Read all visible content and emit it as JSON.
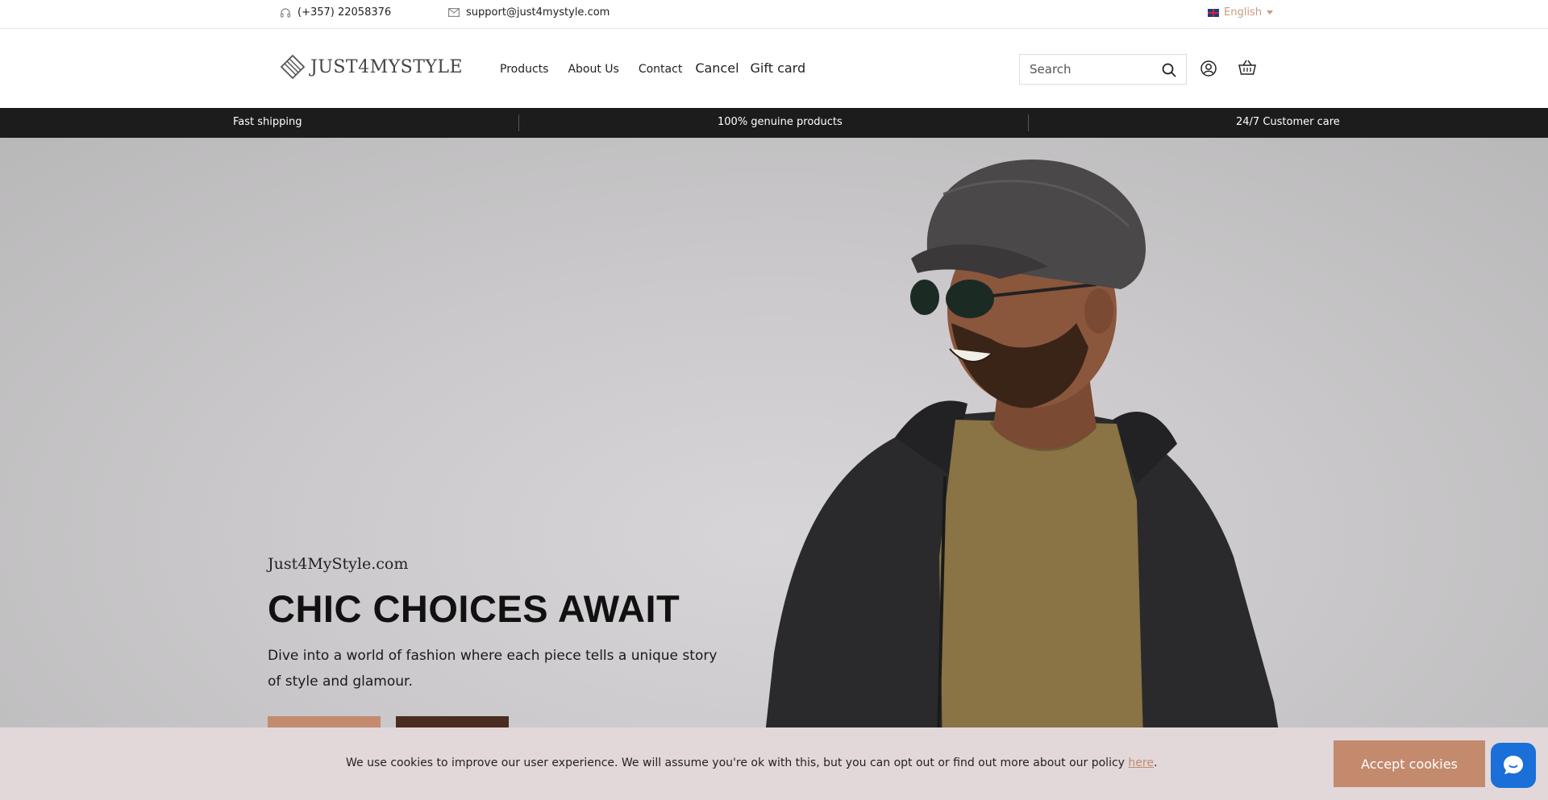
{
  "topbar": {
    "phone": "(+357) 22058376",
    "email": "support@just4mystyle.com",
    "language": "English",
    "icons": [
      "headset-icon",
      "mail-icon",
      "uk-flag-icon",
      "caret-down-icon"
    ]
  },
  "header": {
    "logo_text": "JUST4MYSTYLE",
    "nav": [
      "Products",
      "About Us",
      "Contact",
      "Cancel",
      "Gift card"
    ],
    "search_placeholder": "Search",
    "icons": [
      "search-icon",
      "user-icon",
      "basket-icon"
    ]
  },
  "strip": {
    "items": [
      "Fast shipping",
      "100% genuine products",
      "24/7 Customer care"
    ]
  },
  "hero": {
    "subtitle": "Just4MyStyle.com",
    "title": "CHIC CHOICES AWAIT",
    "description": "Dive into a world of fashion where each piece tells a unique story of style and glamour."
  },
  "cookie": {
    "text": "We use cookies to improve our user experience. We will assume you're ok with this, but you can opt out or find out more about our policy",
    "link_text": "here",
    "period": ".",
    "accept_label": "Accept cookies"
  },
  "colors": {
    "accent": "#c38a6e",
    "dark_button": "#4a2c20",
    "strip_bg": "#1c1c1c",
    "cookie_bg": "#e2d8da",
    "chat_bg": "#1a6fd8"
  }
}
